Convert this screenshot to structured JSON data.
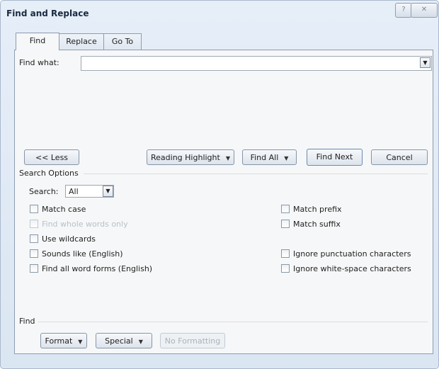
{
  "window": {
    "title": "Find and Replace",
    "help_glyph": "?",
    "close_glyph": "✕"
  },
  "tabs": [
    {
      "label": "Find",
      "active": true
    },
    {
      "label": "Replace",
      "active": false
    },
    {
      "label": "Go To",
      "active": false
    }
  ],
  "find": {
    "label": "Find what:",
    "value": ""
  },
  "buttons": {
    "less": "<< Less",
    "reading_highlight": "Reading Highlight",
    "find_all": "Find All",
    "find_next": "Find Next",
    "cancel": "Cancel"
  },
  "search_options": {
    "heading": "Search Options",
    "search_label": "Search:",
    "search_value": "All",
    "left_options": [
      {
        "label": "Match case",
        "checked": false,
        "enabled": true
      },
      {
        "label": "Find whole words only",
        "checked": false,
        "enabled": false
      },
      {
        "label": "Use wildcards",
        "checked": false,
        "enabled": true
      },
      {
        "label": "Sounds like (English)",
        "checked": false,
        "enabled": true
      },
      {
        "label": "Find all word forms (English)",
        "checked": false,
        "enabled": true
      }
    ],
    "right_options": [
      {
        "label": "Match prefix",
        "checked": false,
        "enabled": true
      },
      {
        "label": "Match suffix",
        "checked": false,
        "enabled": true
      },
      {
        "label": "Ignore punctuation characters",
        "checked": false,
        "enabled": true
      },
      {
        "label": "Ignore white-space characters",
        "checked": false,
        "enabled": true
      }
    ]
  },
  "find_section": {
    "heading": "Find",
    "format": "Format",
    "special": "Special",
    "no_formatting": "No Formatting"
  },
  "colors": {
    "window_bg": "#dbe6f3",
    "panel_bg": "#f6f7f8",
    "disabled_text": "#b8c0c8"
  }
}
